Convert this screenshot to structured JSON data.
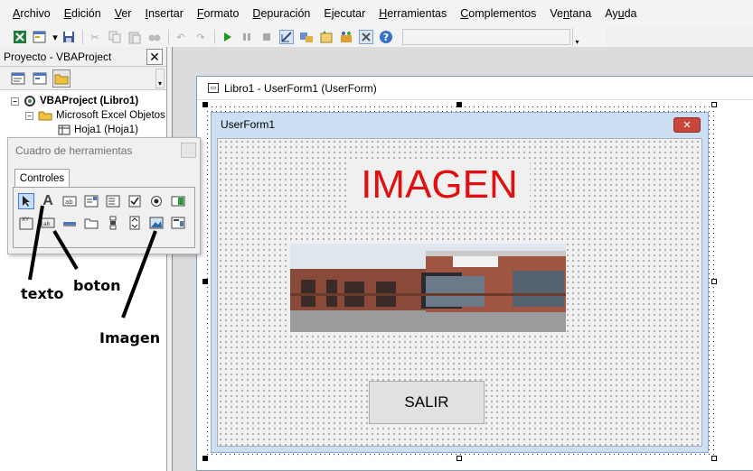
{
  "menu": [
    {
      "label": "Archivo",
      "key": "A"
    },
    {
      "label": "Edición",
      "key": "E"
    },
    {
      "label": "Ver",
      "key": "V"
    },
    {
      "label": "Insertar",
      "key": "I"
    },
    {
      "label": "Formato",
      "key": "F"
    },
    {
      "label": "Depuración",
      "key": "D"
    },
    {
      "label": "Ejecutar",
      "key": "j"
    },
    {
      "label": "Herramientas",
      "key": "H"
    },
    {
      "label": "Complementos",
      "key": "C"
    },
    {
      "label": "Ventana",
      "key": "n"
    },
    {
      "label": "Ayuda",
      "key": "u"
    }
  ],
  "project": {
    "title": "Proyecto - VBAProject",
    "tree": {
      "root": "VBAProject (Libro1)",
      "folder": "Microsoft Excel Objetos",
      "sheet": "Hoja1 (Hoja1)"
    }
  },
  "designer": {
    "window_title": "Libro1 - UserForm1 (UserForm)",
    "userform_caption": "UserForm1",
    "label_text": "IMAGEN",
    "button_caption": "SALIR",
    "label_color": "#e01010"
  },
  "toolbox": {
    "title": "Cuadro de herramientas",
    "tab": "Controles"
  },
  "annotations": {
    "texto": "texto",
    "boton": "boton",
    "imagen": "Imagen"
  }
}
